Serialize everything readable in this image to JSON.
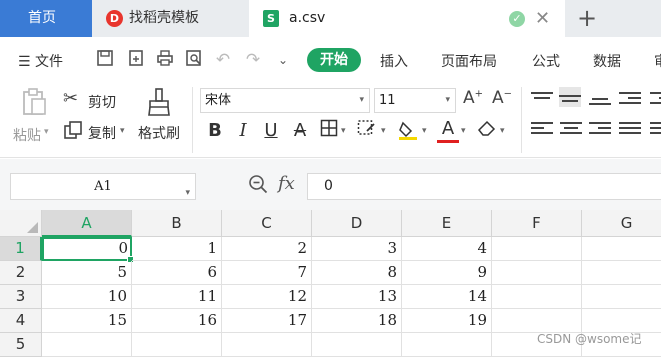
{
  "tabs": {
    "home": "首页",
    "template": "找稻壳模板",
    "template_logo": "D",
    "file": "a.csv",
    "file_icon": "S",
    "new_tab": "+"
  },
  "menu": {
    "file_menu": "文件",
    "items": [
      "开始",
      "插入",
      "页面布局",
      "公式",
      "数据",
      "审"
    ]
  },
  "ribbon": {
    "paste": "粘贴",
    "cut": "剪切",
    "copy": "复制",
    "format_painter": "格式刷",
    "font_name": "宋体",
    "font_size": "11",
    "bold": "B",
    "italic": "I",
    "underline": "U"
  },
  "formula_bar": {
    "cell_ref": "A1",
    "fx": "fx",
    "value": "0"
  },
  "sheet": {
    "columns": [
      "A",
      "B",
      "C",
      "D",
      "E",
      "F",
      "G"
    ],
    "rows": [
      "1",
      "2",
      "3",
      "4",
      "5"
    ],
    "cells": [
      [
        "0",
        "1",
        "2",
        "3",
        "4",
        "",
        ""
      ],
      [
        "5",
        "6",
        "7",
        "8",
        "9",
        "",
        ""
      ],
      [
        "10",
        "11",
        "12",
        "13",
        "14",
        "",
        ""
      ],
      [
        "15",
        "16",
        "17",
        "18",
        "19",
        "",
        ""
      ],
      [
        "",
        "",
        "",
        "",
        "",
        "",
        ""
      ]
    ],
    "active_cell": "A1"
  },
  "watermark": "CSDN @wsome记",
  "colors": {
    "accent": "#1fa463",
    "home_tab": "#3a7bd5"
  }
}
